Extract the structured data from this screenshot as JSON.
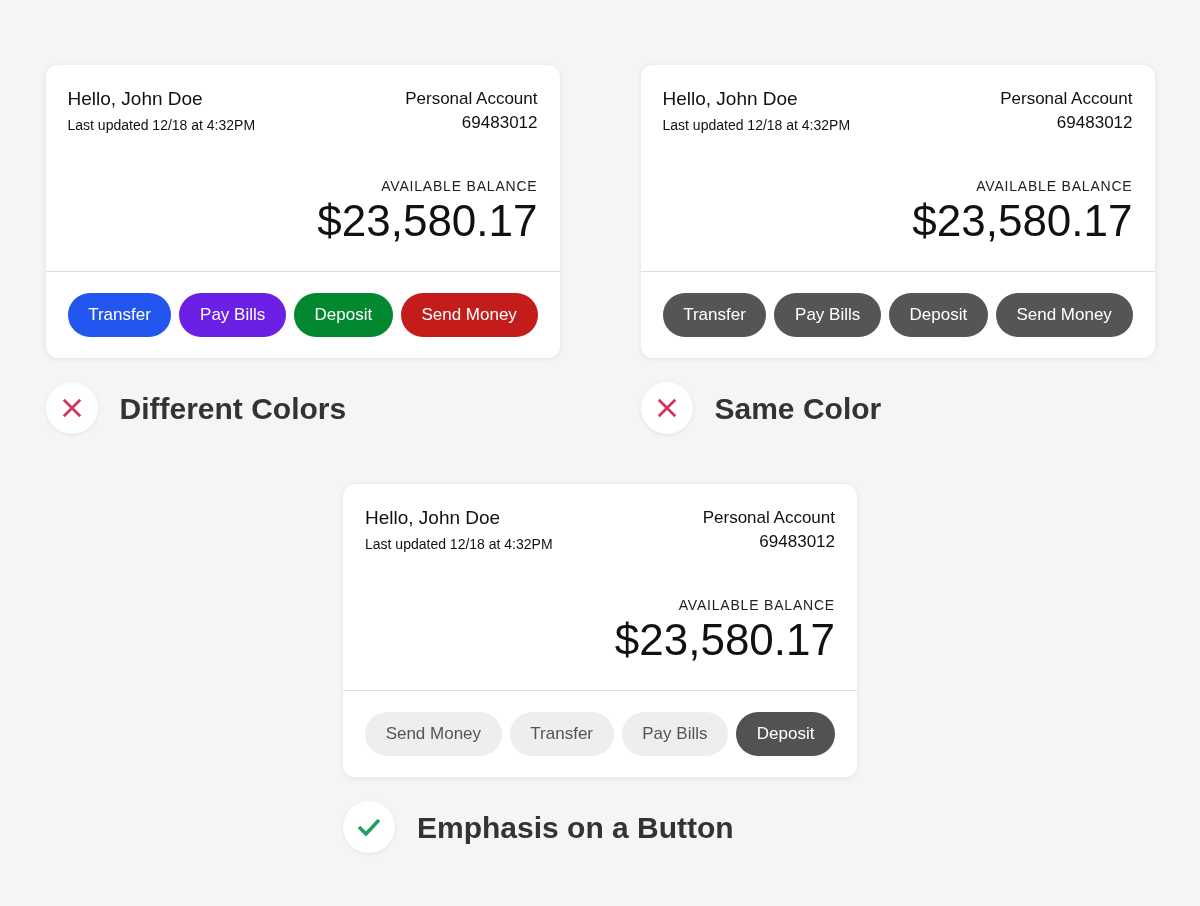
{
  "examples": [
    {
      "card": {
        "greeting": "Hello, John Doe",
        "last_updated": "Last updated 12/18 at 4:32PM",
        "account_type": "Personal Account",
        "account_number": "69483012",
        "balance_label": "AVAILABLE BALANCE",
        "balance": "$23,580.17",
        "buttons": [
          {
            "label": "Transfer",
            "color": "#2356ee"
          },
          {
            "label": "Pay Bills",
            "color": "#6c1fe5"
          },
          {
            "label": "Deposit",
            "color": "#02882f"
          },
          {
            "label": "Send Money",
            "color": "#c41b1b"
          }
        ]
      },
      "verdict": {
        "kind": "bad",
        "label": "Different Colors"
      }
    },
    {
      "card": {
        "greeting": "Hello, John Doe",
        "last_updated": "Last updated 12/18 at 4:32PM",
        "account_type": "Personal Account",
        "account_number": "69483012",
        "balance_label": "AVAILABLE BALANCE",
        "balance": "$23,580.17",
        "buttons": [
          {
            "label": "Transfer",
            "color": "#555555"
          },
          {
            "label": "Pay Bills",
            "color": "#555555"
          },
          {
            "label": "Deposit",
            "color": "#555555"
          },
          {
            "label": "Send Money",
            "color": "#555555"
          }
        ]
      },
      "verdict": {
        "kind": "bad",
        "label": "Same Color"
      }
    },
    {
      "card": {
        "greeting": "Hello, John Doe",
        "last_updated": "Last updated 12/18 at 4:32PM",
        "account_type": "Personal Account",
        "account_number": "69483012",
        "balance_label": "AVAILABLE BALANCE",
        "balance": "$23,580.17",
        "buttons": [
          {
            "label": "Send Money",
            "emphasized": false
          },
          {
            "label": "Transfer",
            "emphasized": false
          },
          {
            "label": "Pay Bills",
            "emphasized": false
          },
          {
            "label": "Deposit",
            "emphasized": true
          }
        ]
      },
      "verdict": {
        "kind": "good",
        "label": "Emphasis on a Button"
      }
    }
  ]
}
